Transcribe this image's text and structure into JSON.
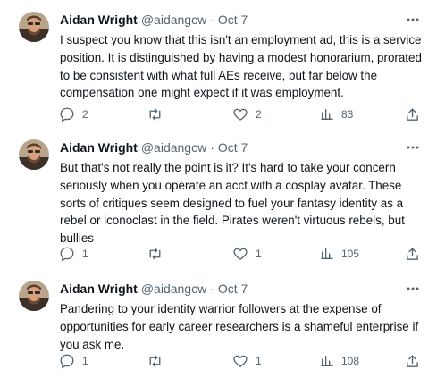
{
  "author": {
    "name": "Aidan Wright",
    "handle": "@aidangcw",
    "separator": "·",
    "date": "Oct 7"
  },
  "tweets": [
    {
      "text": "I suspect you know that this isn't an employment ad, this is a service position. It is distinguished by having a modest honorarium, prorated to be consistent with what full AEs receive, but far below the compensation one might expect if it was employment.",
      "replies": "2",
      "retweets": "",
      "likes": "2",
      "views": "83"
    },
    {
      "text": "But that's not really the point is it? It's hard to take your concern seriously when you operate an acct with a cosplay avatar. These sorts of critiques seem designed to fuel your fantasy identity as a rebel or iconoclast in the field. Pirates weren't virtuous rebels, but bullies",
      "replies": "1",
      "retweets": "",
      "likes": "1",
      "views": "105"
    },
    {
      "text": "Pandering to your identity warrior followers at the expense of opportunities for early career researchers is a shameful enterprise if you ask me.",
      "replies": "1",
      "retweets": "",
      "likes": "1",
      "views": "108"
    }
  ],
  "colors": {
    "text": "#0f1419",
    "secondary": "#536471",
    "icon": "#536471"
  },
  "icons": [
    "avatar",
    "more-icon",
    "reply-icon",
    "retweet-icon",
    "like-icon",
    "views-icon",
    "share-icon"
  ]
}
